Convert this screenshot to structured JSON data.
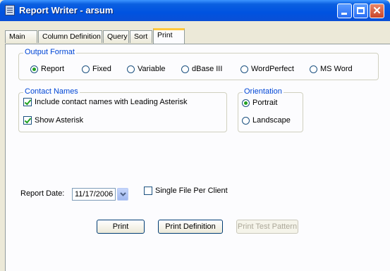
{
  "window": {
    "title": "Report Writer - arsum"
  },
  "tabs": [
    "Main",
    "Column Definition",
    "Query",
    "Sort",
    "Print"
  ],
  "active_tab": "Print",
  "output_format": {
    "title": "Output Format",
    "options": [
      "Report",
      "Fixed",
      "Variable",
      "dBase III",
      "WordPerfect",
      "MS Word"
    ],
    "selected": "Report"
  },
  "contact_names": {
    "title": "Contact Names",
    "include_leading_asterisk": {
      "label": "Include contact names with Leading Asterisk",
      "checked": true
    },
    "show_asterisk": {
      "label": "Show Asterisk",
      "checked": true
    }
  },
  "orientation": {
    "title": "Orientation",
    "options": [
      "Portrait",
      "Landscape"
    ],
    "selected": "Portrait"
  },
  "report_date": {
    "label": "Report Date:",
    "value": "11/17/2006"
  },
  "single_file": {
    "label": "Single File Per Client",
    "checked": false
  },
  "buttons": {
    "print": "Print",
    "print_definition": "Print Definition",
    "print_test_pattern": "Print Test Pattern"
  },
  "colors": {
    "title_bar": "#0053e0",
    "group_title": "#0046d5",
    "radio_dot": "#21a121",
    "active_tab_accent": "#ffc83c"
  }
}
